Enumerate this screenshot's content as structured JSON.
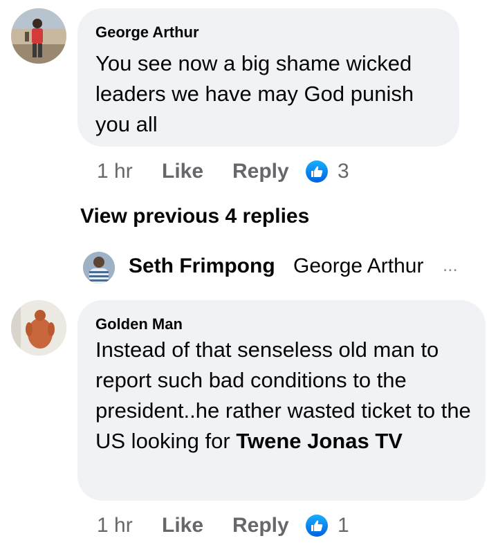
{
  "comments": [
    {
      "author": "George Arthur",
      "text": "You see now a big shame wicked leaders we have may God punish you all",
      "time": "1 hr",
      "like_label": "Like",
      "reply_label": "Reply",
      "reaction_count": "3"
    },
    {
      "author": "Golden Man",
      "text_before": "Instead of that senseless old man to report such bad conditions to the president..he rather wasted ticket to the US looking for ",
      "text_tag": "Twene Jonas TV",
      "time": "1 hr",
      "like_label": "Like",
      "reply_label": "Reply",
      "reaction_count": "1"
    }
  ],
  "view_previous": "View previous 4 replies",
  "reply_preview": {
    "author": "Seth Frimpong",
    "text": "George Arthur",
    "ellipsis": "..."
  },
  "icons": {
    "reaction": "like-thumbs-up-icon"
  },
  "colors": {
    "bubble": "#f0f2f5",
    "secondary_text": "#65676b",
    "like_blue": "#1877f2"
  }
}
